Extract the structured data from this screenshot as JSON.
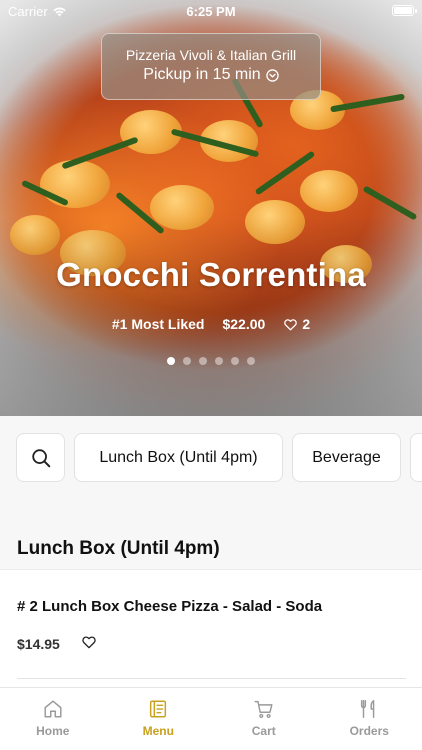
{
  "status_bar": {
    "carrier": "Carrier",
    "time": "6:25 PM"
  },
  "restaurant": {
    "name": "Pizzeria Vivoli & Italian Grill",
    "pickup": "Pickup in 15 min"
  },
  "featured": {
    "title": "Gnocchi Sorrentina",
    "rank": "#1 Most Liked",
    "price": "$22.00",
    "likes": "2",
    "carousel_total": 6,
    "carousel_active": 1
  },
  "categories": [
    "Lunch Box (Until 4pm)",
    "Beverage"
  ],
  "section_title": "Lunch Box (Until 4pm)",
  "items": [
    {
      "name": "# 2 Lunch Box Cheese Pizza - Salad - Soda",
      "price": "$14.95"
    }
  ],
  "tabs": [
    {
      "label": "Home",
      "icon": "home-icon"
    },
    {
      "label": "Menu",
      "icon": "menu-icon"
    },
    {
      "label": "Cart",
      "icon": "cart-icon"
    },
    {
      "label": "Orders",
      "icon": "utensils-icon"
    }
  ],
  "active_tab": "Menu",
  "colors": {
    "accent": "#c9a020",
    "inactive": "#9a9a9a"
  }
}
